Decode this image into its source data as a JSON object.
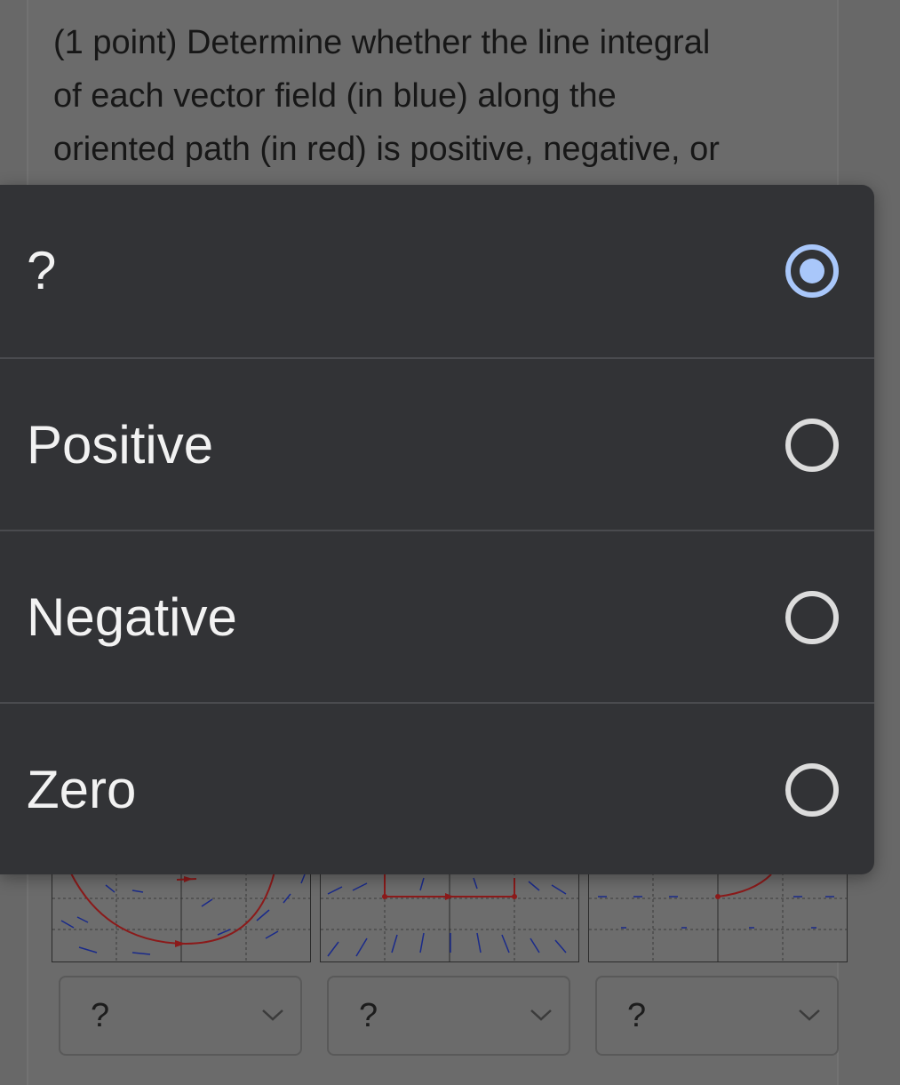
{
  "question": {
    "lines": [
      "(1 point) Determine whether the line integral",
      "of each vector field (in blue) along the",
      "oriented path (in red) is positive, negative, or"
    ]
  },
  "dropdown_sheet": {
    "options": [
      {
        "label": "?",
        "selected": true
      },
      {
        "label": "Positive",
        "selected": false
      },
      {
        "label": "Negative",
        "selected": false
      },
      {
        "label": "Zero",
        "selected": false
      }
    ],
    "accent_color": "#a9c7fa"
  },
  "answer_selects": [
    {
      "value": "?"
    },
    {
      "value": "?"
    },
    {
      "value": "?"
    }
  ],
  "icons": {
    "radio": "radio-button-icon",
    "select_chevron": "chevron-down-icon"
  }
}
